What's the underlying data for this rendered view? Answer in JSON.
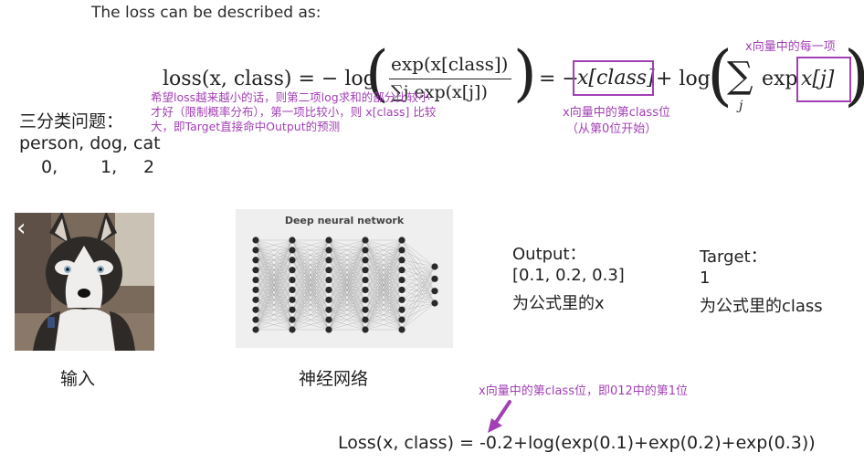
{
  "header": {
    "text": "The loss can be described as:"
  },
  "formula": {
    "lhs": "loss(x, class) = − log",
    "frac_num": "exp(x[class])",
    "frac_den": "∑j exp(x[j])",
    "eq2": "= −",
    "term1": "x[class]",
    "plus_log": "+ log",
    "sum_sym": "∑",
    "sum_sub": "j",
    "exp_word": "exp",
    "term2": "x[j]"
  },
  "annotations": {
    "note_loss": "希望loss越来越小的话，则第二项log求和的部分比较小才好（限制概率分布），第一项比较小，则 x[class] 比较大，即Target直接命中Output的预测",
    "note_class_index_1": "x向量中的第class位",
    "note_class_index_2": "（从第0位开始）",
    "note_each": "x向量中的每一项",
    "note_arrow": "x向量中的第class位，即012中的第1位"
  },
  "problem": {
    "title": "三分类问题：",
    "classes": "person, dog, cat",
    "indices": [
      "0,",
      "1,",
      "2"
    ]
  },
  "pipeline": {
    "input_label": "输入",
    "network_title": "Deep neural network",
    "network_label": "神经网络",
    "output_title": "Output：",
    "output_value": "[0.1, 0.2, 0.3]",
    "output_desc": "为公式里的x",
    "target_title": "Target：",
    "target_value": "1",
    "target_desc": "为公式里的class"
  },
  "computation": {
    "text": "Loss(x, class) = -0.2+log(exp(0.1)+exp(0.2)+exp(0.3))"
  },
  "icons": {
    "carousel_prev": "chevron-left-icon"
  },
  "colors": {
    "annotation": "#a23fb5",
    "text": "#222222"
  }
}
